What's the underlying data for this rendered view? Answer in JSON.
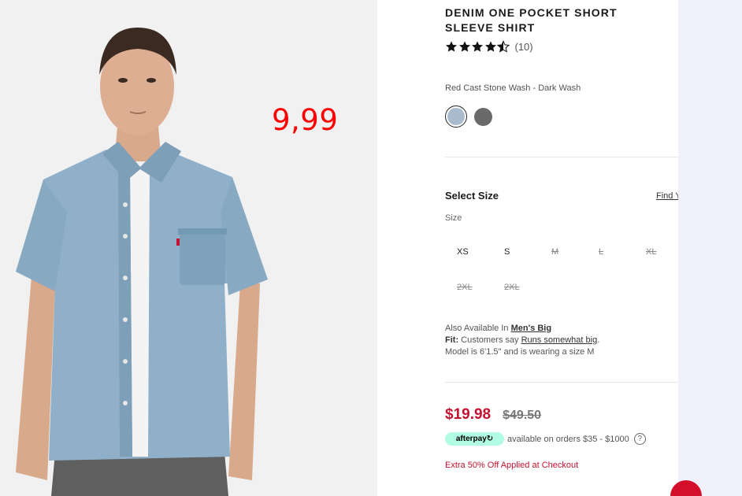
{
  "overlay": {
    "price_text": "9,99"
  },
  "product": {
    "title": "DENIM ONE POCKET SHORT SLEEVE SHIRT",
    "rating_value": 4.5,
    "review_count": "(10)",
    "color_name": "Red Cast Stone Wash - Dark Wash",
    "swatches": [
      {
        "name": "Red Cast Stone Wash - Dark Wash",
        "color": "#a9bccd",
        "selected": true
      },
      {
        "name": "dark-swatch",
        "color": "#6a6a6a",
        "selected": false
      }
    ]
  },
  "size": {
    "heading": "Select Size",
    "find_link": "Find Y",
    "label": "Size",
    "options": [
      {
        "label": "XS",
        "available": true
      },
      {
        "label": "S",
        "available": true
      },
      {
        "label": "M",
        "available": false
      },
      {
        "label": "L",
        "available": false
      },
      {
        "label": "XL",
        "available": false
      },
      {
        "label": "2XL",
        "available": false
      },
      {
        "label": "2XL",
        "available": false
      }
    ]
  },
  "availability": {
    "also_prefix": "Also Available In ",
    "also_link": "Men's Big",
    "fit_label": "Fit:",
    "fit_text": " Customers say ",
    "fit_link": "Runs somewhat big",
    "fit_end": ".",
    "model_text": "Model is 6'1.5\" and is wearing a size M"
  },
  "pricing": {
    "sale": "$19.98",
    "original": "$49.50",
    "afterpay_label": "afterpay↻",
    "afterpay_text": "available on orders $35 - $1000",
    "help_symbol": "?",
    "promo": "Extra 50% Off Applied at Checkout"
  },
  "colors": {
    "accent_red": "#c41230",
    "overlay_red": "#ff0000",
    "afterpay_mint": "#b2fce4",
    "star": "#111111"
  }
}
